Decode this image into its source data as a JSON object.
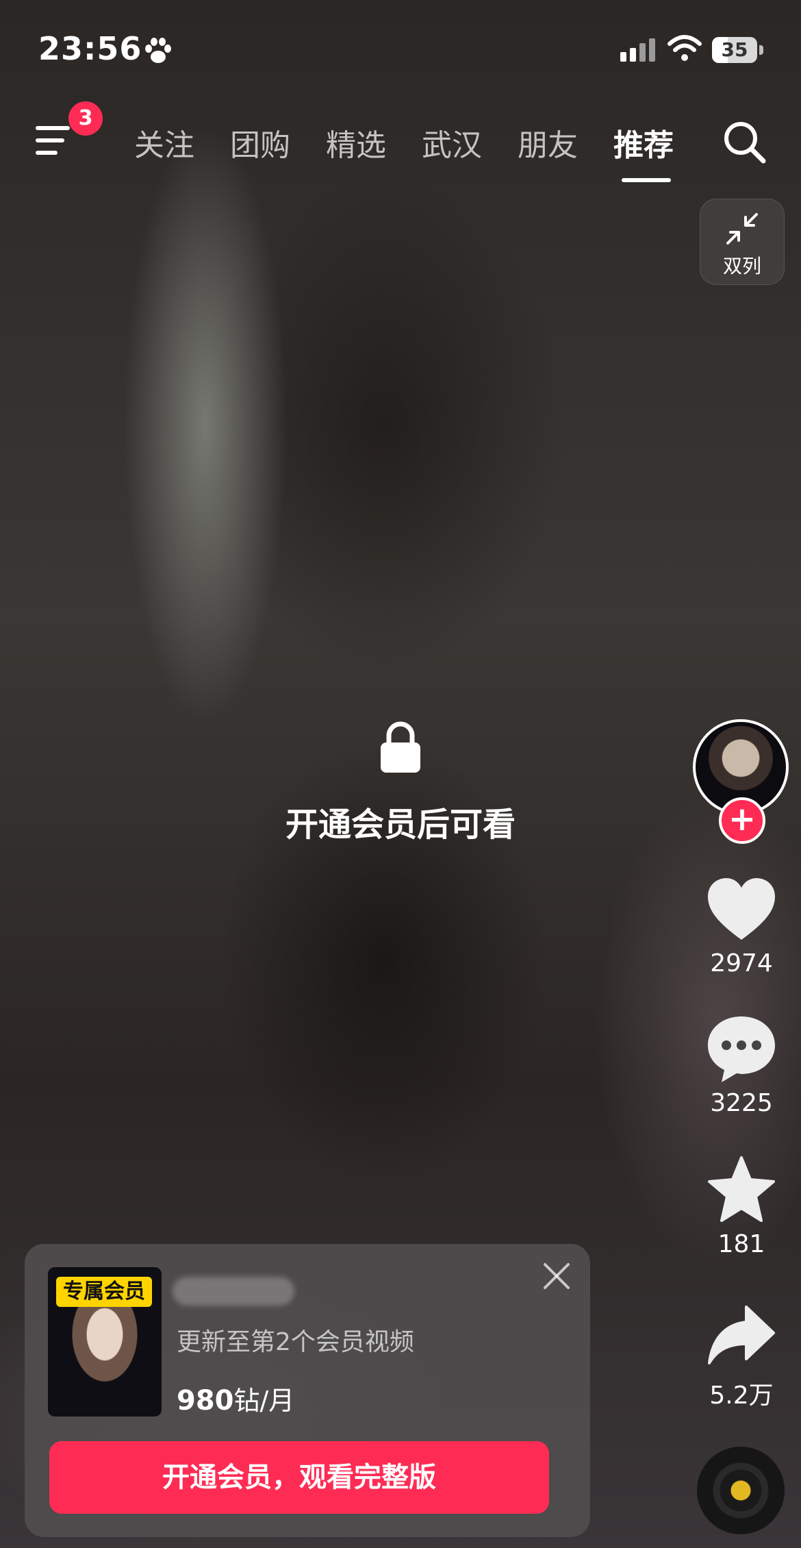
{
  "status_bar": {
    "time": "23:56",
    "battery": "35",
    "battery_level": 0.35
  },
  "top_nav": {
    "notification_count": "3",
    "tabs": [
      {
        "label": "关注"
      },
      {
        "label": "团购"
      },
      {
        "label": "精选"
      },
      {
        "label": "武汉"
      },
      {
        "label": "朋友"
      },
      {
        "label": "推荐",
        "active": true
      }
    ]
  },
  "layout_toggle": {
    "label": "双列"
  },
  "video": {
    "lock_message": "开通会员后可看"
  },
  "right_rail": {
    "follow_symbol": "+",
    "likes": "2974",
    "comments": "3225",
    "favorites": "181",
    "shares": "5.2万"
  },
  "member_card": {
    "thumb_badge": "专属会员",
    "subtitle": "更新至第2个会员视频",
    "price_amount": "980",
    "price_unit": "钻/月",
    "cta_label": "开通会员，观看完整版"
  },
  "colors": {
    "accent": "#fe2c55",
    "badge_yellow": "#ffd400"
  },
  "icons": [
    "paw-icon",
    "signal-icon",
    "wifi-icon",
    "battery-icon",
    "menu-icon",
    "search-icon",
    "collapse-icon",
    "lock-icon",
    "heart-icon",
    "comment-icon",
    "star-icon",
    "share-icon",
    "close-icon",
    "music-disc-icon"
  ]
}
